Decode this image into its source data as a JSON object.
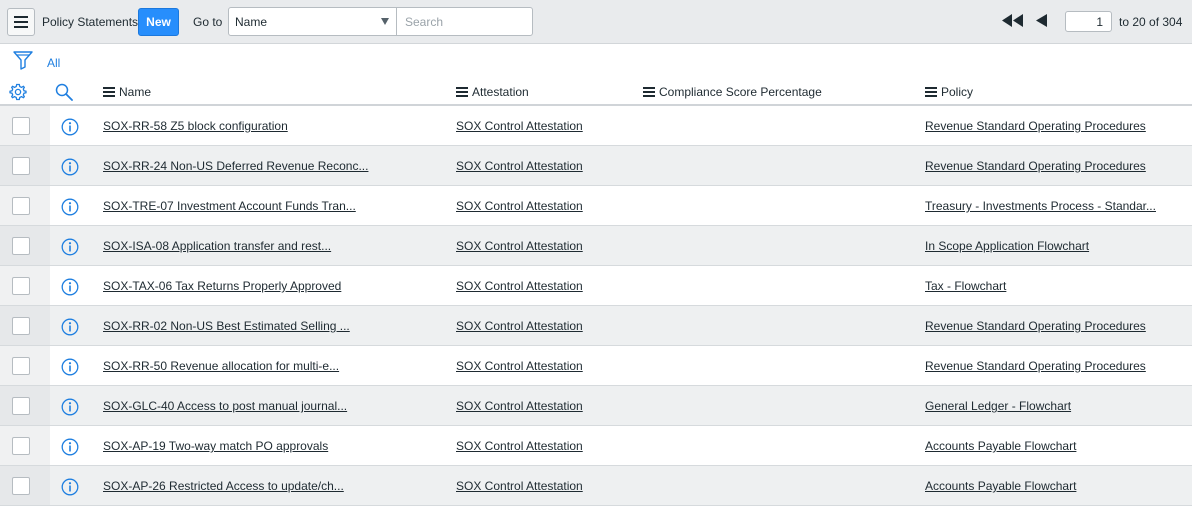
{
  "header": {
    "title": "Policy Statements",
    "new_label": "New",
    "goto_label": "Go to",
    "goto_selected": "Name",
    "search_placeholder": "Search",
    "page_number": "1",
    "page_range": "to 20 of 304"
  },
  "filter": {
    "label": "All"
  },
  "columns": {
    "name": "Name",
    "attestation": "Attestation",
    "compliance": "Compliance Score Percentage",
    "policy": "Policy"
  },
  "rows": [
    {
      "name": "SOX-RR-58 Z5 block configuration",
      "attestation": "SOX Control Attestation",
      "compliance": "",
      "policy": "Revenue Standard Operating Procedures"
    },
    {
      "name": "SOX-RR-24 Non-US Deferred Revenue Reconc...",
      "attestation": "SOX Control Attestation",
      "compliance": "",
      "policy": "Revenue Standard Operating Procedures"
    },
    {
      "name": "SOX-TRE-07 Investment Account Funds Tran...",
      "attestation": "SOX Control Attestation",
      "compliance": "",
      "policy": "Treasury - Investments Process - Standar..."
    },
    {
      "name": "SOX-ISA-08 Application transfer and rest...",
      "attestation": "SOX Control Attestation",
      "compliance": "",
      "policy": "In Scope Application Flowchart"
    },
    {
      "name": "SOX-TAX-06 Tax Returns Properly Approved",
      "attestation": "SOX Control Attestation",
      "compliance": "",
      "policy": "Tax - Flowchart"
    },
    {
      "name": "SOX-RR-02 Non-US Best Estimated Selling ...",
      "attestation": "SOX Control Attestation",
      "compliance": "",
      "policy": "Revenue Standard Operating Procedures"
    },
    {
      "name": "SOX-RR-50 Revenue allocation for multi-e...",
      "attestation": "SOX Control Attestation",
      "compliance": "",
      "policy": "Revenue Standard Operating Procedures"
    },
    {
      "name": "SOX-GLC-40 Access to post manual journal...",
      "attestation": "SOX Control Attestation",
      "compliance": "",
      "policy": "General Ledger - Flowchart"
    },
    {
      "name": "SOX-AP-19 Two-way match PO approvals",
      "attestation": "SOX Control Attestation",
      "compliance": "",
      "policy": "Accounts Payable Flowchart"
    },
    {
      "name": "SOX-AP-26 Restricted Access to update/ch...",
      "attestation": "SOX Control Attestation",
      "compliance": "",
      "policy": "Accounts Payable Flowchart"
    }
  ],
  "colors": {
    "accent": "#278efc",
    "link_blue": "#1f7fe0",
    "header_bg": "#e9ebed",
    "row_alt": "#eef0f1"
  },
  "icons": {
    "menu": "hamburger-icon",
    "first_page": "double-triangle-left-icon",
    "prev_page": "triangle-left-icon",
    "filter": "funnel-icon",
    "settings": "gear-icon",
    "search": "magnifier-icon",
    "column_menu": "column-menu-icon",
    "record_info": "info-circle-icon"
  }
}
